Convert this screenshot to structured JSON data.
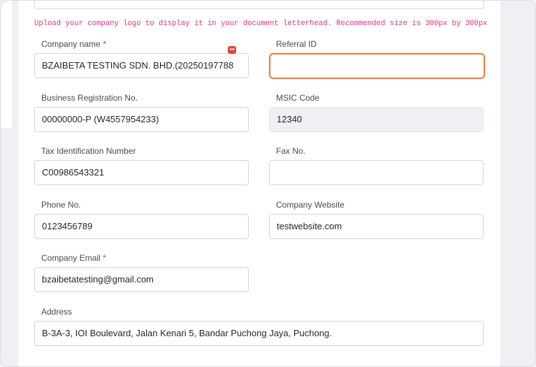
{
  "upload_hint": "Upload your company logo to display it in your document letterhead. Recommended size is 300px by 300px",
  "fields": {
    "company_name": {
      "label": "Company name",
      "required": "*",
      "value": "BZAIBETA TESTING SDN. BHD.(20250197788"
    },
    "referral_id": {
      "label": "Referral ID",
      "value": ""
    },
    "business_reg": {
      "label": "Business Registration No.",
      "value": "00000000-P (W4557954233)"
    },
    "msic_code": {
      "label": "MSIC Code",
      "value": "12340"
    },
    "tax_id": {
      "label": "Tax Identification Number",
      "value": "C00986543321"
    },
    "fax": {
      "label": "Fax No.",
      "value": ""
    },
    "phone": {
      "label": "Phone No.",
      "value": "0123456789"
    },
    "website": {
      "label": "Company Website",
      "value": "testwebsite.com"
    },
    "email": {
      "label": "Company Email",
      "required": "*",
      "value": "bzaibetatesting@gmail.com"
    },
    "address": {
      "label": "Address",
      "value": "B-3A-3, IOI Boulevard, Jalan Kenari 5, Bandar Puchong Jaya, Puchong."
    }
  },
  "icons": {
    "company_name_badge": "chat-bubble-icon"
  },
  "colors": {
    "accent_focus": "#f07d3e",
    "hint": "#e0317a",
    "required": "#d63a3a"
  }
}
